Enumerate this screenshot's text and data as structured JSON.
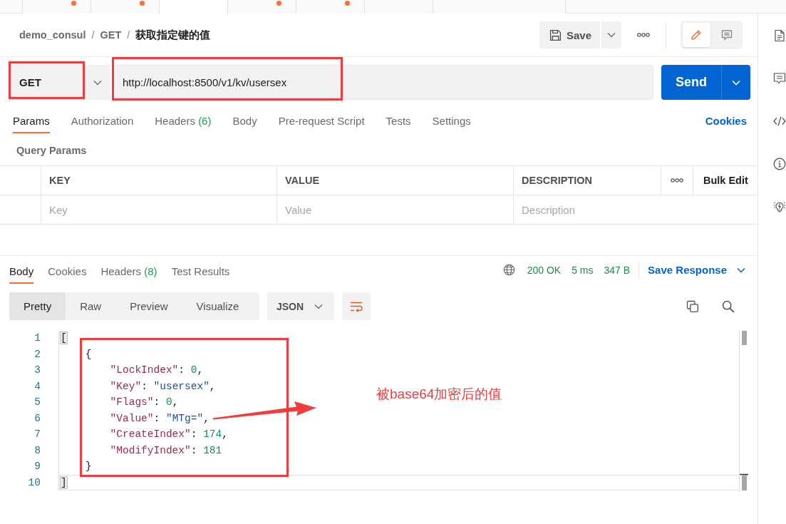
{
  "tab_strip": {
    "tabs": [
      {
        "selected": false,
        "unsaved": true
      },
      {
        "selected": false,
        "unsaved": true
      },
      {
        "selected": true,
        "unsaved": false
      },
      {
        "selected": false,
        "unsaved": true
      },
      {
        "selected": false,
        "unsaved": true
      },
      {
        "selected": false,
        "unsaved": false
      },
      {
        "selected": false,
        "unsaved": false
      }
    ]
  },
  "header": {
    "breadcrumb": [
      {
        "text": "demo_consul",
        "current": false
      },
      {
        "separator": "/",
        "text": "GET",
        "current": false
      },
      {
        "separator": "/",
        "text": "获取指定键的值",
        "current": true
      }
    ],
    "save_label": "Save",
    "view_toggle": [
      {
        "kind": "edit",
        "selected": true
      },
      {
        "kind": "comments",
        "selected": false
      }
    ]
  },
  "request": {
    "method": "GET",
    "url": "http://localhost:8500/v1/kv/usersex",
    "send_label": "Send"
  },
  "request_tabs": [
    {
      "label": "Params",
      "selected": true
    },
    {
      "label": "Authorization",
      "selected": false
    },
    {
      "label": "Headers",
      "count": "(6)",
      "selected": false
    },
    {
      "label": "Body",
      "selected": false
    },
    {
      "label": "Pre-request Script",
      "selected": false
    },
    {
      "label": "Tests",
      "selected": false
    },
    {
      "label": "Settings",
      "selected": false
    }
  ],
  "cookies_link": "Cookies",
  "query_params": {
    "title": "Query Params",
    "columns": [
      "KEY",
      "VALUE",
      "DESCRIPTION"
    ],
    "bulk_edit": "Bulk Edit",
    "placeholders": [
      "Key",
      "Value",
      "Description"
    ]
  },
  "response": {
    "tabs": [
      {
        "label": "Body",
        "selected": true
      },
      {
        "label": "Cookies",
        "selected": false
      },
      {
        "label": "Headers",
        "count": "(8)",
        "selected": false
      },
      {
        "label": "Test Results",
        "selected": false
      }
    ],
    "status": "200 OK",
    "time": "5 ms",
    "size": "347 B",
    "save_label": "Save Response",
    "views": [
      {
        "label": "Pretty",
        "selected": true
      },
      {
        "label": "Raw",
        "selected": false
      },
      {
        "label": "Preview",
        "selected": false
      },
      {
        "label": "Visualize",
        "selected": false
      }
    ],
    "format": "JSON",
    "code": [
      {
        "number": "1",
        "active": false,
        "tokens": [
          {
            "kind": "bracket_match",
            "text": "["
          }
        ],
        "children": [
          {
            "number": "2",
            "active": false,
            "tokens": [
              {
                "kind": "punct",
                "text": "{"
              }
            ],
            "children": [
              {
                "number": "3",
                "active": false,
                "tokens": [
                  {
                    "kind": "key",
                    "text": "\"LockIndex\""
                  },
                  {
                    "kind": "punct",
                    "text": ": "
                  },
                  {
                    "kind": "number",
                    "text": "0"
                  },
                  {
                    "kind": "punct",
                    "text": ","
                  }
                ]
              },
              {
                "number": "4",
                "active": false,
                "tokens": [
                  {
                    "kind": "key",
                    "text": "\"Key\""
                  },
                  {
                    "kind": "punct",
                    "text": ": "
                  },
                  {
                    "kind": "string",
                    "text": "\"usersex\""
                  },
                  {
                    "kind": "punct",
                    "text": ","
                  }
                ]
              },
              {
                "number": "5",
                "active": false,
                "tokens": [
                  {
                    "kind": "key",
                    "text": "\"Flags\""
                  },
                  {
                    "kind": "punct",
                    "text": ": "
                  },
                  {
                    "kind": "number",
                    "text": "0"
                  },
                  {
                    "kind": "punct",
                    "text": ","
                  }
                ]
              },
              {
                "number": "6",
                "active": false,
                "tokens": [
                  {
                    "kind": "key",
                    "text": "\"Value\""
                  },
                  {
                    "kind": "punct",
                    "text": ": "
                  },
                  {
                    "kind": "string",
                    "text": "\"MTg=\""
                  },
                  {
                    "kind": "punct",
                    "text": ","
                  }
                ]
              },
              {
                "number": "7",
                "active": false,
                "tokens": [
                  {
                    "kind": "key",
                    "text": "\"CreateIndex\""
                  },
                  {
                    "kind": "punct",
                    "text": ": "
                  },
                  {
                    "kind": "number",
                    "text": "174"
                  },
                  {
                    "kind": "punct",
                    "text": ","
                  }
                ]
              },
              {
                "number": "8",
                "active": false,
                "tokens": [
                  {
                    "kind": "key",
                    "text": "\"ModifyIndex\""
                  },
                  {
                    "kind": "punct",
                    "text": ": "
                  },
                  {
                    "kind": "number",
                    "text": "181"
                  }
                ]
              }
            ]
          },
          {
            "number": "9",
            "active": false,
            "tokens": [
              {
                "kind": "punct",
                "text": "}"
              }
            ]
          }
        ]
      },
      {
        "number": "10",
        "active": true,
        "tokens": [
          {
            "kind": "bracket_match",
            "text": "]"
          }
        ]
      }
    ]
  },
  "annotation": {
    "note": "被base64加密后的值"
  }
}
